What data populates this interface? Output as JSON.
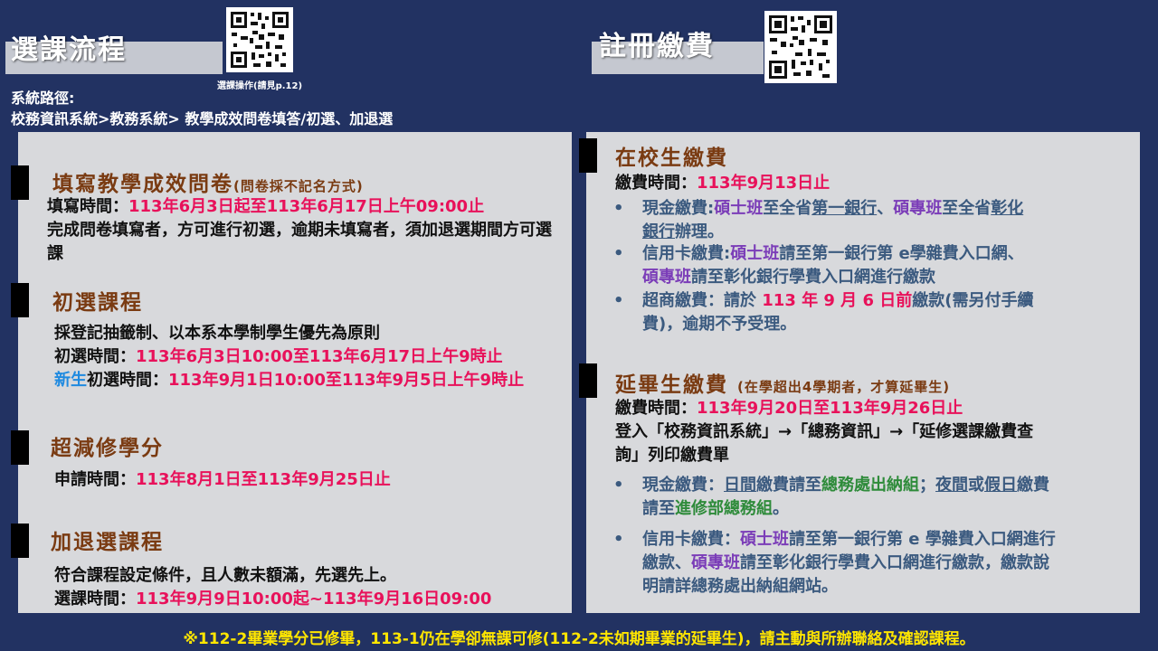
{
  "left": {
    "title": "選課流程",
    "qr_caption": "選課操作(請見p.12)",
    "path_label": "系統路徑:",
    "path_value": "校務資訊系統>教務系統> 教學成效問卷填答/初選、加退選",
    "sections": {
      "survey": {
        "heading": "填寫教學成效問卷",
        "heading_note": "(問卷採不記名方式)",
        "time_label": "填寫時間：",
        "time_value": "113年6月3日起至113年6月17日上午09:00止",
        "desc": "完成問卷填寫者，方可進行初選，逾期未填寫者，須加退選期間方可選課"
      },
      "initial": {
        "heading": "初選課程",
        "rule": "採登記抽籤制、以本系本學制學生優先為原則",
        "time_label": "初選時間：",
        "time_value": "113年6月3日10:00至113年6月17日上午9時止",
        "new_label": "新生",
        "new_time_label": "初選時間：",
        "new_time_value": "113年9月1日10:00至113年9月5日上午9時止"
      },
      "reduce": {
        "heading": "超減修學分",
        "time_label": "申請時間：",
        "time_value": "113年8月1日至113年9月25日止"
      },
      "add_drop": {
        "heading": "加退選課程",
        "desc": "符合課程設定條件，且人數未額滿，先選先上。",
        "time_label": "選課時間：",
        "time_value": "113年9月9日10:00起~113年9月16日09:00"
      }
    }
  },
  "right": {
    "title": "註冊繳費",
    "enrolled": {
      "heading": "在校生繳費",
      "time_label": "繳費時間：",
      "time_value": "113年9月13日止",
      "cash": {
        "p1": "現金繳費:",
        "p2": "碩士班",
        "p3": "至全省",
        "p4": "第一銀行",
        "p5": "、",
        "p6": "碩專班",
        "p7": "至全省",
        "p8": "彰化",
        "p9": "銀行",
        "p10": "辦理。"
      },
      "card": {
        "p1": "信用卡繳費:",
        "p2": "碩士班",
        "p3": "請至第一銀行第 e學雜費入口網、",
        "p4": "碩專班",
        "p5": "請至彰化銀行學費入口網進行繳款"
      },
      "store": {
        "p1": "超商繳費：請於 ",
        "p2": "113 年 9 月 6 日前",
        "p3": "繳款(需另付手續",
        "p4": "費)，逾期不予受理。"
      }
    },
    "extended": {
      "heading": "延畢生繳費",
      "heading_note": "(在學超出4學期者，才算延畢生)",
      "time_label": "繳費時間：",
      "time_value": "113年9月20日至113年9月26日止",
      "login_line1": "登入「校務資訊系統」→「總務資訊」→「延修選課繳費查",
      "login_line2": "詢」列印繳費單",
      "cash": {
        "p1": "現金繳費：",
        "p2": "日間",
        "p3": "繳費請至",
        "p4": "總務處出納組",
        "p5": "；",
        "p6": "夜間",
        "p7": "或",
        "p8": "假日",
        "p9": "繳費",
        "p10": "請至",
        "p11": "進修部總務組",
        "p12": "。"
      },
      "card": {
        "p1": "信用卡繳費：",
        "p2": "碩士班",
        "p3": "請至第一銀行第 e 學雜費入口網進行",
        "p4": "繳款、",
        "p5": "碩專班",
        "p6": "請至彰化銀行學費入口網進行繳款，繳款說",
        "p7": "明請詳總務處出納組網站。"
      }
    }
  },
  "bullet_char": "•",
  "footer": "※112-2畢業學分已修畢，113-1仍在學卻無課可修(112-2未如期畢業的延畢生)，請主動與所辦聯絡及確認課程。"
}
